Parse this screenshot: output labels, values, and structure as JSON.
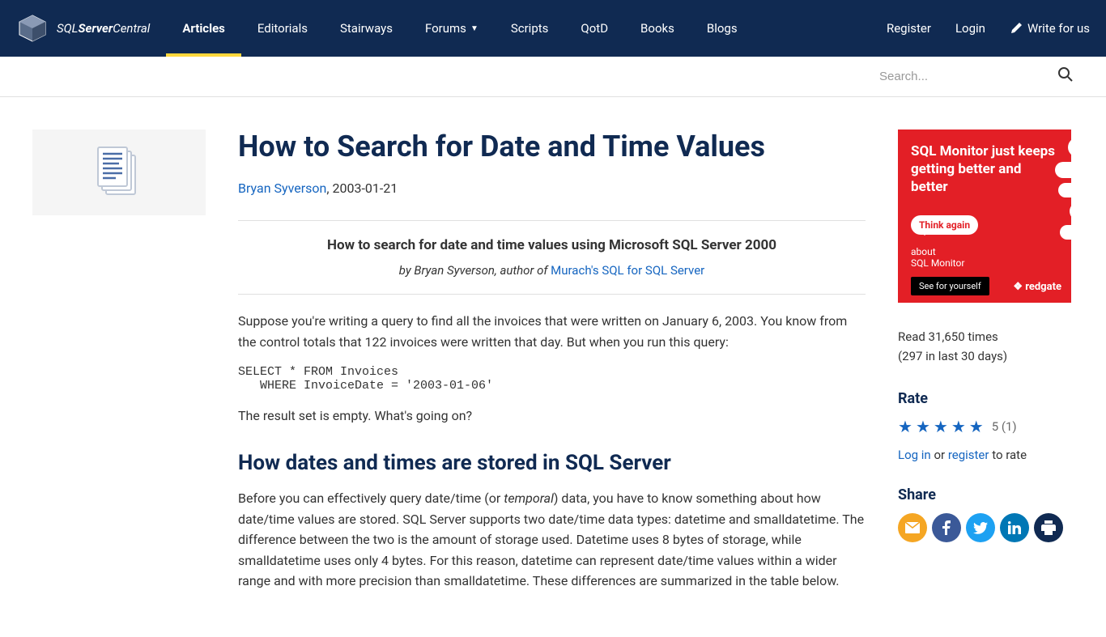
{
  "brand": {
    "name_prefix": "SQL",
    "name_bold": "Server",
    "name_suffix": "Central"
  },
  "nav": {
    "items": [
      {
        "label": "Articles",
        "active": true,
        "dropdown": false
      },
      {
        "label": "Editorials",
        "active": false,
        "dropdown": false
      },
      {
        "label": "Stairways",
        "active": false,
        "dropdown": false
      },
      {
        "label": "Forums",
        "active": false,
        "dropdown": true
      },
      {
        "label": "Scripts",
        "active": false,
        "dropdown": false
      },
      {
        "label": "QotD",
        "active": false,
        "dropdown": false
      },
      {
        "label": "Books",
        "active": false,
        "dropdown": false
      },
      {
        "label": "Blogs",
        "active": false,
        "dropdown": false
      }
    ],
    "right": {
      "register": "Register",
      "login": "Login",
      "write": "Write for us"
    }
  },
  "search": {
    "placeholder": "Search..."
  },
  "article": {
    "title": "How to Search for Date and Time Values",
    "author": "Bryan Syverson",
    "date": "2003-01-21",
    "subtitle": "How to search for date and time values using Microsoft SQL Server 2000",
    "credit_prefix": "by Bryan Syverson, author of ",
    "credit_link": "Murach's SQL for SQL Server",
    "para1": "Suppose you're writing a query to find all the invoices that were written on January 6, 2003. You know from the control totals that 122 invoices were written that day. But when you run this query:",
    "code1": "SELECT * FROM Invoices\n   WHERE InvoiceDate = '2003-01-06'",
    "para2": "The result set is empty. What's going on?",
    "h2_1": "How dates and times are stored in SQL Server",
    "para3_a": "Before you can effectively query date/time (or ",
    "para3_i": "temporal",
    "para3_b": ") data, you have to know something about how date/time values are stored. SQL Server supports two date/time data types: datetime and smalldatetime. The difference between the two is the amount of storage used. Datetime uses 8 bytes of storage, while smalldatetime uses only 4 bytes. For this reason, datetime can represent date/time values within a wider range and with more precision than smalldatetime. These differences are summarized in the table below."
  },
  "sidebar": {
    "ad": {
      "headline": "SQL Monitor just keeps getting better and better",
      "think": "Think again",
      "about": "about\nSQL Monitor",
      "button": "See for yourself",
      "brand": "redgate"
    },
    "stats": {
      "line1": "Read 31,650 times",
      "line2": "(297 in last 30 days)"
    },
    "rate": {
      "heading": "Rate",
      "score": "5 (1)",
      "login": "Log in",
      "or": " or ",
      "register": "register",
      "suffix": " to rate"
    },
    "share": {
      "heading": "Share"
    }
  }
}
